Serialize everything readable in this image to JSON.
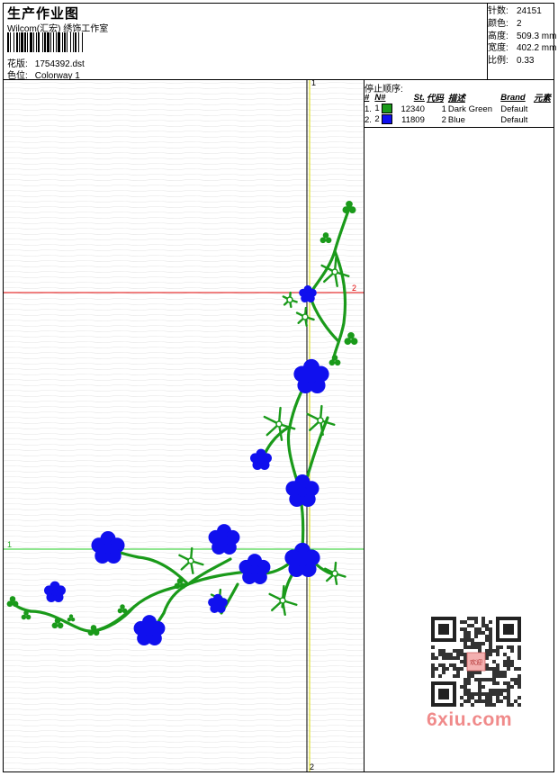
{
  "header": {
    "title": "生产作业图",
    "company": "Wilcom(汇宏) 绣饰工作室",
    "design_label": "花版:",
    "design_value": "1754392.dst",
    "colorway_label": "色位:",
    "colorway_value": "Colorway 1"
  },
  "stats": {
    "stitches_label": "针数:",
    "stitches_value": "24151",
    "colors_label": "颜色:",
    "colors_value": "2",
    "height_label": "高度:",
    "height_value": "509.3 mm",
    "width_label": "宽度:",
    "width_value": "402.2 mm",
    "scale_label": "比例:",
    "scale_value": "0.33"
  },
  "sequence": {
    "title": "停止顺序:",
    "columns": [
      "#",
      "N#",
      "St.",
      "代码",
      "描述",
      "Brand",
      "元素"
    ],
    "rows": [
      {
        "idx": "1.",
        "n": "1",
        "color": "#1a9a1a",
        "st": "12340",
        "code": "1",
        "desc": "Dark Green",
        "brand": "Default",
        "element": ""
      },
      {
        "idx": "2.",
        "n": "2",
        "color": "#1010ee",
        "st": "11809",
        "code": "2",
        "desc": "Blue",
        "brand": "Default",
        "element": ""
      }
    ]
  },
  "canvas": {
    "v_top_label": "1",
    "v_bottom_label": "2",
    "red_line_label": "2",
    "green_line_label": "1"
  },
  "colors": {
    "dark_green": "#1a9a1a",
    "blue": "#1010ee",
    "red_guide": "#e00000",
    "green_guide": "#22cc22",
    "yellow_guide": "#d8d800"
  },
  "watermark": {
    "text": "6xiu.com"
  },
  "qr": {
    "stamp": "欢迎"
  }
}
